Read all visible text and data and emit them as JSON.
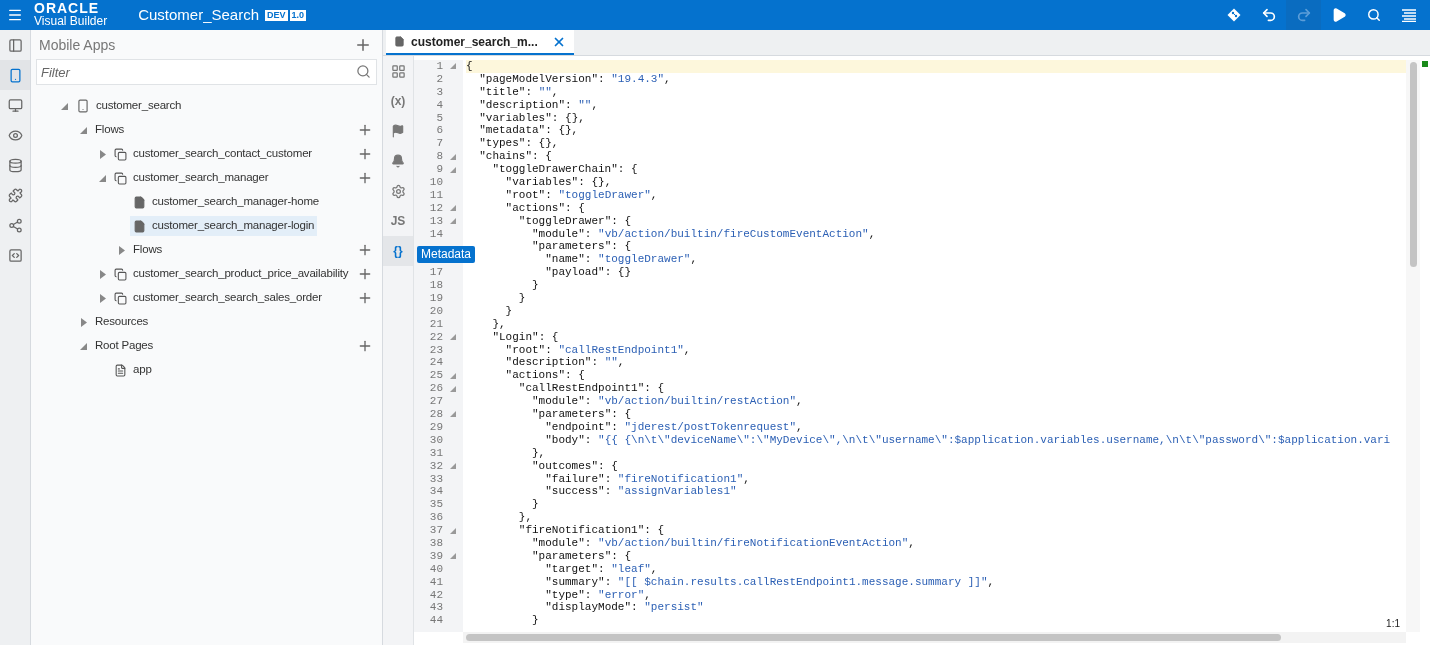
{
  "header": {
    "logo_top": "ORACLE",
    "logo_bottom": "Visual Builder",
    "title": "Customer_Search",
    "badges": [
      "DEV",
      "1.0"
    ],
    "actions": [
      {
        "kind": "git",
        "disabled": false
      },
      {
        "kind": "undo",
        "disabled": false
      },
      {
        "kind": "redo",
        "disabled": true
      },
      {
        "kind": "run",
        "disabled": false
      },
      {
        "kind": "search",
        "disabled": false
      },
      {
        "kind": "menu",
        "disabled": false
      }
    ]
  },
  "activity_bar": [
    {
      "kind": "navigator",
      "selected": false
    },
    {
      "kind": "mobile",
      "selected": true
    },
    {
      "kind": "web",
      "selected": false
    },
    {
      "kind": "services",
      "selected": false
    },
    {
      "kind": "data",
      "selected": false
    },
    {
      "kind": "components",
      "selected": false
    },
    {
      "kind": "processes",
      "selected": false
    },
    {
      "kind": "source",
      "selected": false
    }
  ],
  "sidebar": {
    "title": "Mobile Apps",
    "filter_placeholder": "Filter",
    "tree": [
      {
        "label": "customer_search",
        "kind": "app",
        "expanded": true,
        "selected": false,
        "add": false,
        "children": [
          {
            "label": "Flows",
            "expanded": true,
            "selected": false,
            "add": true,
            "children": [
              {
                "label": "customer_search_contact_customer",
                "kind": "flow",
                "expanded": false,
                "selected": false,
                "add": true
              },
              {
                "label": "customer_search_manager",
                "kind": "flow",
                "expanded": true,
                "selected": false,
                "add": true,
                "children": [
                  {
                    "label": "customer_search_manager-home",
                    "kind": "page",
                    "selected": false,
                    "add": false
                  },
                  {
                    "label": "customer_search_manager-login",
                    "kind": "page",
                    "selected": true,
                    "add": false
                  },
                  {
                    "label": "Flows",
                    "expanded": false,
                    "selected": false,
                    "add": true
                  }
                ]
              },
              {
                "label": "customer_search_product_price_availability",
                "kind": "flow",
                "expanded": false,
                "selected": false,
                "add": true
              },
              {
                "label": "customer_search_search_sales_order",
                "kind": "flow",
                "expanded": false,
                "selected": false,
                "add": true
              }
            ]
          },
          {
            "label": "Resources",
            "expanded": false,
            "selected": false,
            "add": false
          },
          {
            "label": "Root Pages",
            "expanded": true,
            "selected": false,
            "add": true,
            "children": [
              {
                "label": "app",
                "kind": "root_page",
                "selected": false,
                "add": false
              }
            ]
          }
        ]
      }
    ]
  },
  "editor": {
    "tabs": [
      {
        "label": "customer_search_m...",
        "selected": true
      }
    ],
    "tools": [
      {
        "kind": "components",
        "selected": false
      },
      {
        "kind": "glyph",
        "label": "(x)",
        "selected": false
      },
      {
        "kind": "events",
        "selected": false
      },
      {
        "kind": "notifications",
        "selected": false
      },
      {
        "kind": "settings",
        "selected": false
      },
      {
        "kind": "glyph",
        "label": "JS",
        "selected": false
      },
      {
        "kind": "glyph",
        "label": "{}",
        "selected": true
      }
    ],
    "tooltip": "Metadata",
    "cursor": "1:1",
    "lines": [
      {
        "num": "1",
        "fold": true,
        "current": true,
        "text": "{"
      },
      {
        "num": "2",
        "fold": false,
        "current": false,
        "text": "  \"pageModelVersion\": \"19.4.3\","
      },
      {
        "num": "3",
        "fold": false,
        "current": false,
        "text": "  \"title\": \"\","
      },
      {
        "num": "4",
        "fold": false,
        "current": false,
        "text": "  \"description\": \"\","
      },
      {
        "num": "5",
        "fold": false,
        "current": false,
        "text": "  \"variables\": {},"
      },
      {
        "num": "6",
        "fold": false,
        "current": false,
        "text": "  \"metadata\": {},"
      },
      {
        "num": "7",
        "fold": false,
        "current": false,
        "text": "  \"types\": {},"
      },
      {
        "num": "8",
        "fold": true,
        "current": false,
        "text": "  \"chains\": {"
      },
      {
        "num": "9",
        "fold": true,
        "current": false,
        "text": "    \"toggleDrawerChain\": {"
      },
      {
        "num": "10",
        "fold": false,
        "current": false,
        "text": "      \"variables\": {},"
      },
      {
        "num": "11",
        "fold": false,
        "current": false,
        "text": "      \"root\": \"toggleDrawer\","
      },
      {
        "num": "12",
        "fold": true,
        "current": false,
        "text": "      \"actions\": {"
      },
      {
        "num": "13",
        "fold": true,
        "current": false,
        "text": "        \"toggleDrawer\": {"
      },
      {
        "num": "14",
        "fold": false,
        "current": false,
        "text": "          \"module\": \"vb/action/builtin/fireCustomEventAction\","
      },
      {
        "fold": false,
        "current": false,
        "text": "          \"parameters\": {"
      },
      {
        "fold": false,
        "current": false,
        "text": "            \"name\": \"toggleDrawer\","
      },
      {
        "num": "17",
        "fold": false,
        "current": false,
        "text": "            \"payload\": {}"
      },
      {
        "num": "18",
        "fold": false,
        "current": false,
        "text": "          }"
      },
      {
        "num": "19",
        "fold": false,
        "current": false,
        "text": "        }"
      },
      {
        "num": "20",
        "fold": false,
        "current": false,
        "text": "      }"
      },
      {
        "num": "21",
        "fold": false,
        "current": false,
        "text": "    },"
      },
      {
        "num": "22",
        "fold": true,
        "current": false,
        "text": "    \"Login\": {"
      },
      {
        "num": "23",
        "fold": false,
        "current": false,
        "text": "      \"root\": \"callRestEndpoint1\","
      },
      {
        "num": "24",
        "fold": false,
        "current": false,
        "text": "      \"description\": \"\","
      },
      {
        "num": "25",
        "fold": true,
        "current": false,
        "text": "      \"actions\": {"
      },
      {
        "num": "26",
        "fold": true,
        "current": false,
        "text": "        \"callRestEndpoint1\": {"
      },
      {
        "num": "27",
        "fold": false,
        "current": false,
        "text": "          \"module\": \"vb/action/builtin/restAction\","
      },
      {
        "num": "28",
        "fold": true,
        "current": false,
        "text": "          \"parameters\": {"
      },
      {
        "num": "29",
        "fold": false,
        "current": false,
        "text": "            \"endpoint\": \"jderest/postTokenrequest\","
      },
      {
        "num": "30",
        "fold": false,
        "current": false,
        "text": "            \"body\": \"{{ {\\n\\t\\\"deviceName\\\":\\\"MyDevice\\\",\\n\\t\\\"username\\\":$application.variables.username,\\n\\t\\\"password\\\":$application.vari"
      },
      {
        "num": "31",
        "fold": false,
        "current": false,
        "text": "          },"
      },
      {
        "num": "32",
        "fold": true,
        "current": false,
        "text": "          \"outcomes\": {"
      },
      {
        "num": "33",
        "fold": false,
        "current": false,
        "text": "            \"failure\": \"fireNotification1\","
      },
      {
        "num": "34",
        "fold": false,
        "current": false,
        "text": "            \"success\": \"assignVariables1\""
      },
      {
        "num": "35",
        "fold": false,
        "current": false,
        "text": "          }"
      },
      {
        "num": "36",
        "fold": false,
        "current": false,
        "text": "        },"
      },
      {
        "num": "37",
        "fold": true,
        "current": false,
        "text": "        \"fireNotification1\": {"
      },
      {
        "num": "38",
        "fold": false,
        "current": false,
        "text": "          \"module\": \"vb/action/builtin/fireNotificationEventAction\","
      },
      {
        "num": "39",
        "fold": true,
        "current": false,
        "text": "          \"parameters\": {"
      },
      {
        "num": "40",
        "fold": false,
        "current": false,
        "text": "            \"target\": \"leaf\","
      },
      {
        "num": "41",
        "fold": false,
        "current": false,
        "text": "            \"summary\": \"[[ $chain.results.callRestEndpoint1.message.summary ]]\","
      },
      {
        "num": "42",
        "fold": false,
        "current": false,
        "text": "            \"type\": \"error\","
      },
      {
        "num": "43",
        "fold": false,
        "current": false,
        "text": "            \"displayMode\": \"persist\""
      },
      {
        "num": "44",
        "fold": false,
        "current": false,
        "text": "          }"
      }
    ]
  }
}
